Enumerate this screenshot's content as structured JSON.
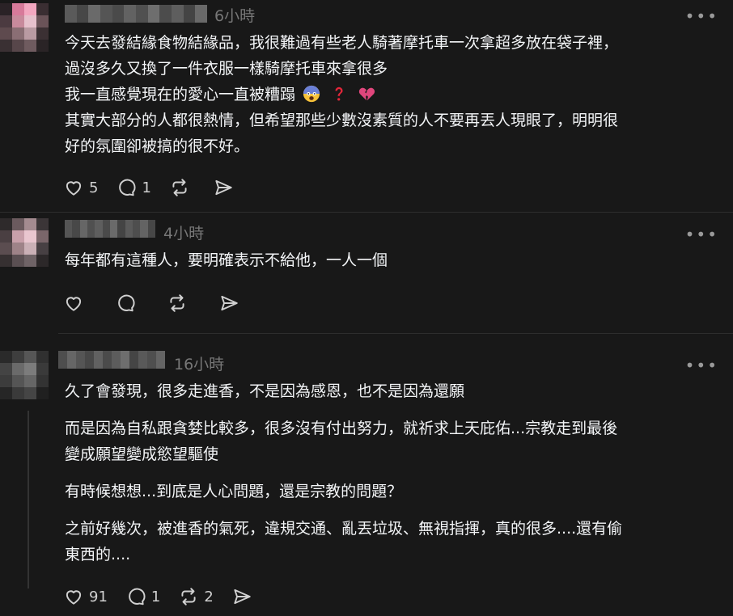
{
  "posts": [
    {
      "time": "6小時",
      "text": [
        "今天去發結緣食物結緣品，我很難過有些老人騎著摩托車一次拿超多放在袋子裡，",
        "過沒多久又換了一件衣服一樣騎摩托車來拿很多",
        "我一直感覺現在的愛心一直被糟蹋",
        "其實大部分的人都很熱情，但希望那些少數沒素質的人不要再丟人現眼了，明明很",
        "好的氛圍卻被搞的很不好。"
      ],
      "emojis": [
        "scared-face",
        "red-question-mark",
        "broken-heart"
      ],
      "likes": "5",
      "replies": "1",
      "reposts": ""
    },
    {
      "time": "4小時",
      "text": [
        "每年都有這種人，要明確表示不給他，一人一個"
      ],
      "likes": "",
      "replies": "",
      "reposts": ""
    },
    {
      "time": "16小時",
      "paragraphs": [
        [
          "久了會發現，很多走進香，不是因為感恩，也不是因為還願"
        ],
        [
          "而是因為自私跟貪婪比較多，很多沒有付出努力，就祈求上天庇佑...宗教走到最後",
          "變成願望變成慾望驅使"
        ],
        [
          "有時候想想...到底是人心問題，還是宗教的問題？"
        ],
        [
          "之前好幾次，被進香的氣死，違規交通、亂丟垃圾、無視指揮，真的很多....還有偷",
          "東西的...."
        ]
      ],
      "likes": "91",
      "replies": "1",
      "reposts": "2"
    }
  ],
  "icons": {
    "like": "heart-icon",
    "reply": "comment-icon",
    "repost": "repost-icon",
    "share": "share-icon",
    "more": "more-icon"
  },
  "colors": {
    "background": "#181818",
    "text": "#f3f5f7",
    "muted": "#777777",
    "divider": "#2d2d2d"
  }
}
